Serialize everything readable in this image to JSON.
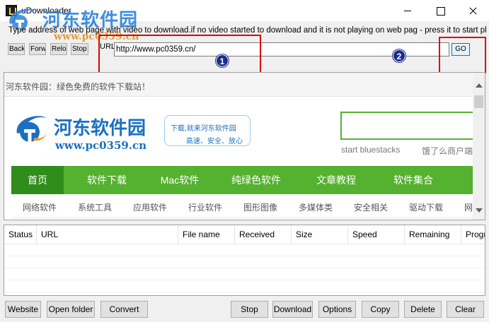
{
  "window": {
    "title": "uDownloader",
    "watermark": "河东软件园",
    "watermark_url": "www.pc0359.cn"
  },
  "hint": "Type address of web page with video to download.if no video started to download and it is not playing on web pag - press it to start playing",
  "nav_buttons": [
    "Back",
    "Forwa",
    "Reloa",
    "Stop"
  ],
  "url": {
    "label": "URL",
    "value": "http://www.pc0359.cn/"
  },
  "go_label": "GO",
  "annotations": [
    "1",
    "2"
  ],
  "page": {
    "topbar": "河东软件园：绿色免费的软件下载站！",
    "logo_text": "河东软件园",
    "logo_url": "www.pc0359.cn",
    "slogan_1": "下载,就来河东软件园",
    "slogan_2": "高速、安全、放心",
    "search_links": [
      "start bluestacks",
      "饿了么商户端"
    ],
    "nav": [
      "首页",
      "软件下载",
      "Mac软件",
      "纯绿色软件",
      "文章教程",
      "软件集合"
    ],
    "subnav": [
      "网络软件",
      "系统工具",
      "应用软件",
      "行业软件",
      "图形图像",
      "多媒体类",
      "安全相关",
      "驱动下载",
      "网"
    ]
  },
  "table": {
    "columns": [
      "Status",
      "URL",
      "File name",
      "Received",
      "Size",
      "Speed",
      "Remaining",
      "Progr"
    ]
  },
  "bottom_buttons": {
    "website": "Website",
    "open_folder": "Open folder",
    "convert": "Convert",
    "stop": "Stop",
    "download": "Download",
    "options": "Options",
    "copy": "Copy",
    "delete": "Delete",
    "clear": "Clear"
  },
  "colors": {
    "accent_blue": "#0078d7",
    "callout_red": "#e10000",
    "site_green": "#55b130",
    "site_blue": "#1b6fc2"
  }
}
